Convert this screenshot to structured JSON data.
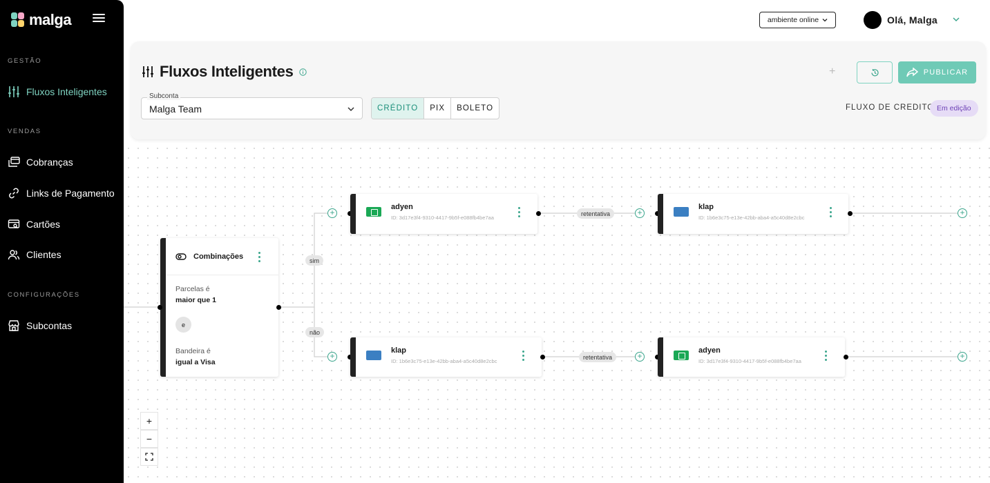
{
  "sidebar": {
    "logo": "malga",
    "sections": {
      "gestao": "GESTÃO",
      "vendas": "VENDAS",
      "configuracoes": "CONFIGURAÇÕES"
    },
    "items": {
      "fluxos": "Fluxos Inteligentes",
      "cobrancas": "Cobranças",
      "links": "Links de Pagamento",
      "cartoes": "Cartões",
      "clientes": "Clientes",
      "subcontas": "Subcontas"
    },
    "active_item": "Fluxos Inteligentes"
  },
  "topbar": {
    "environment": "ambiente online",
    "greeting": "Olá, Malga"
  },
  "header": {
    "title": "Fluxos Inteligentes",
    "subconta_label": "Subconta",
    "subconta_value": "Malga Team",
    "tabs": [
      "CRÉDITO",
      "PIX",
      "BOLETO"
    ],
    "active_tab": "CRÉDITO",
    "add_label": "+",
    "publish_label": "PUBLICAR",
    "flow_label": "FLUXO DE CREDITO",
    "status": "Em edição"
  },
  "flow": {
    "combination": {
      "title": "Combinações",
      "condition1_label": "Parcelas é",
      "condition1_value": "maior que 1",
      "joiner": "e",
      "condition2_label": "Bandeira é",
      "condition2_value": "igual a Visa"
    },
    "branch_yes": "sim",
    "branch_no": "não",
    "retry_label": "retentativa",
    "nodes": {
      "top_first": {
        "name": "adyen",
        "id": "ID: 3d17e3f4-9310-4417-9b5f-e088fb4be7aa"
      },
      "top_second": {
        "name": "klap",
        "id": "ID: 1b6e3c75-e13e-42bb-aba4-a5c40d8e2cbc"
      },
      "bottom_first": {
        "name": "klap",
        "id": "ID: 1b6e3c75-e13e-42bb-aba4-a5c40d8e2cbc"
      },
      "bottom_second": {
        "name": "adyen",
        "id": "ID: 3d17e3f4-9310-4417-9b5f-e088fb4be7aa"
      }
    }
  },
  "zoom_controls": {
    "zoom_in": "+",
    "zoom_out": "−"
  },
  "colors": {
    "accent": "#6fcab6",
    "sidebar_bg": "#000000",
    "status_badge": "#e6dcf6"
  }
}
